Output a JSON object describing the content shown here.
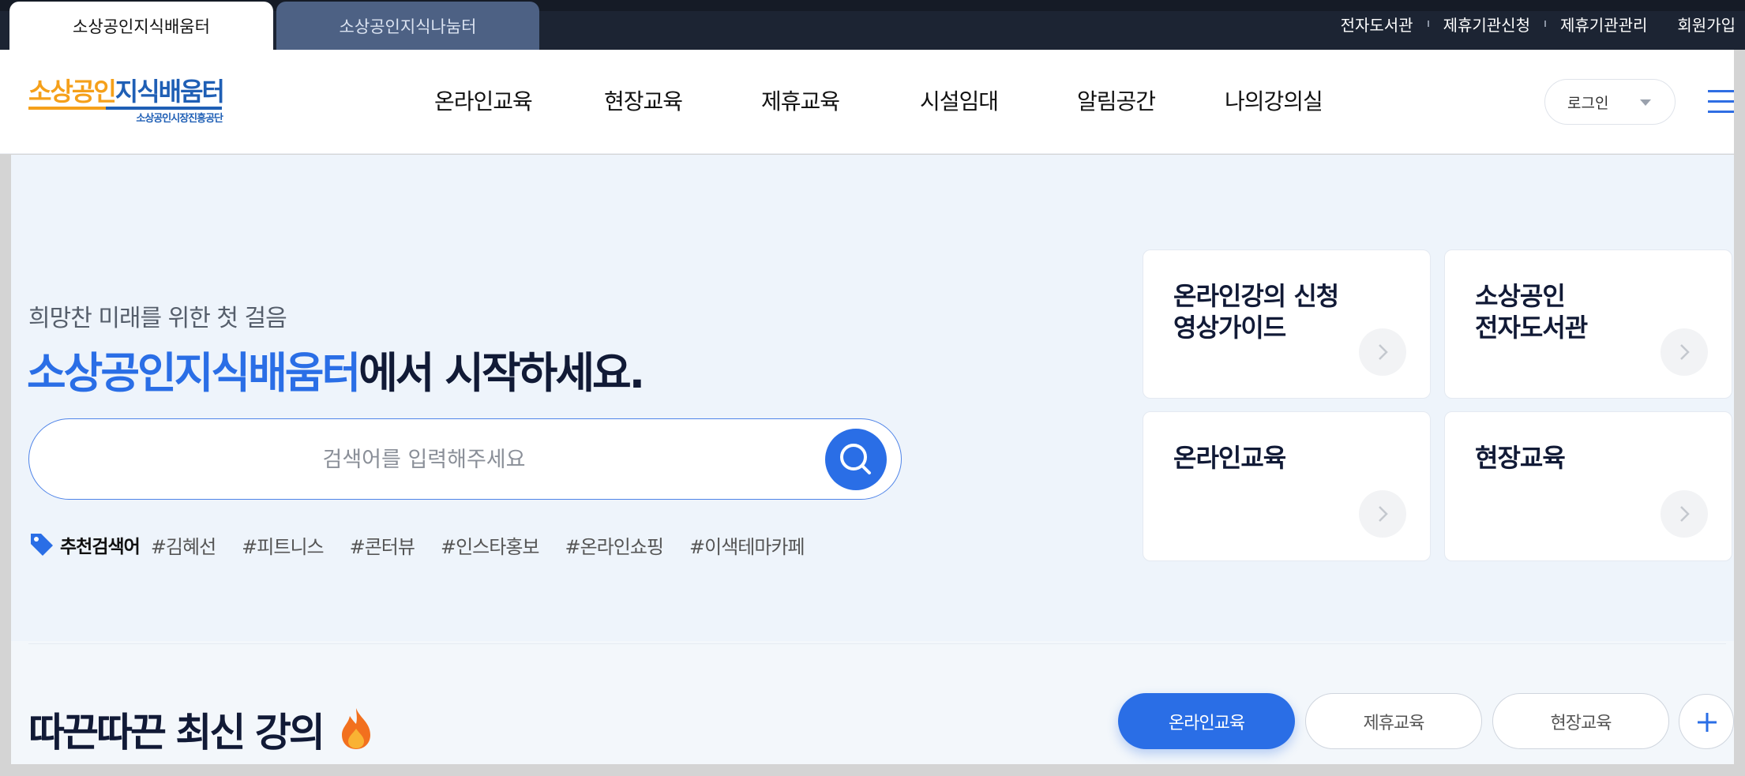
{
  "site_tabs": [
    {
      "label": "소상공인지식배움터",
      "active": true
    },
    {
      "label": "소상공인지식나눔터",
      "active": false
    }
  ],
  "utility_links": [
    "전자도서관",
    "제휴기관신청",
    "제휴기관관리",
    "회원가입"
  ],
  "logo": {
    "orange": "소상공인",
    "blue": "지식배움터",
    "sub": "소상공인시장진흥공단"
  },
  "nav": [
    "온라인교육",
    "현장교육",
    "제휴교육",
    "시설임대",
    "알림공간",
    "나의강의실"
  ],
  "login_label": "로그인",
  "hero": {
    "tagline": "희망찬 미래를 위한 첫 걸음",
    "headline_blue": "소상공인지식배움터",
    "headline_rest": "에서 시작하세요.",
    "search_placeholder": "검색어를 입력해주세요"
  },
  "recommended": {
    "label": "추천검색어",
    "keywords": [
      "#김혜선",
      "#피트니스",
      "#콘터뷰",
      "#인스타홍보",
      "#온라인쇼핑",
      "#이색테마카페"
    ]
  },
  "quick_cards": [
    {
      "title": "온라인강의 신청\n영상가이드"
    },
    {
      "title": "소상공인\n전자도서관"
    },
    {
      "title": "온라인교육"
    },
    {
      "title": "현장교육"
    }
  ],
  "latest": {
    "title": "따끈따끈 최신 강의",
    "tabs": [
      "온라인교육",
      "제휴교육",
      "현장교육"
    ]
  },
  "colors": {
    "accent": "#2a6ee6",
    "navy": "#111a36",
    "orange": "#f5a01a",
    "topbar": "#1c2433"
  }
}
